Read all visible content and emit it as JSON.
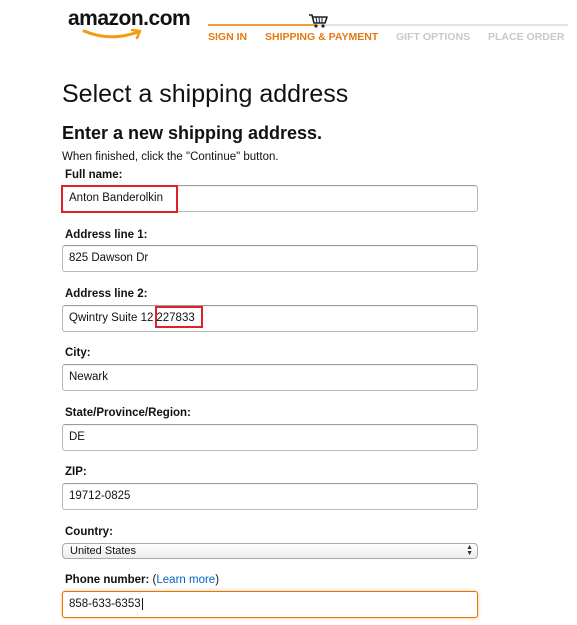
{
  "header": {
    "logo_text": "amazon.com",
    "steps": [
      {
        "label": "SIGN IN",
        "state": "done"
      },
      {
        "label": "SHIPPING & PAYMENT",
        "state": "current"
      },
      {
        "label": "GIFT OPTIONS",
        "state": "upcoming"
      },
      {
        "label": "PLACE ORDER",
        "state": "upcoming"
      }
    ]
  },
  "page": {
    "title": "Select a shipping address",
    "section_title": "Enter a new shipping address.",
    "instructions": "When finished, click the \"Continue\" button."
  },
  "form": {
    "full_name": {
      "label": "Full name:",
      "value": "Anton Banderolkin"
    },
    "address1": {
      "label": "Address line 1:",
      "value": "825 Dawson Dr"
    },
    "address2": {
      "label": "Address line 2:",
      "value": "Qwintry Suite 12",
      "value_highlighted": "227833"
    },
    "city": {
      "label": "City:",
      "value": "Newark"
    },
    "state": {
      "label": "State/Province/Region:",
      "value": "DE"
    },
    "zip": {
      "label": "ZIP:",
      "value": "19712-0825"
    },
    "country": {
      "label": "Country:",
      "value": "United States"
    },
    "phone": {
      "label": "Phone number:",
      "learn_more_prefix": "(",
      "learn_more": "Learn more",
      "learn_more_suffix": ")",
      "value": "858-633-6353"
    }
  },
  "colors": {
    "accent_orange": "#e47911",
    "highlight_red": "#e2202c",
    "link_blue": "#0066c0"
  }
}
